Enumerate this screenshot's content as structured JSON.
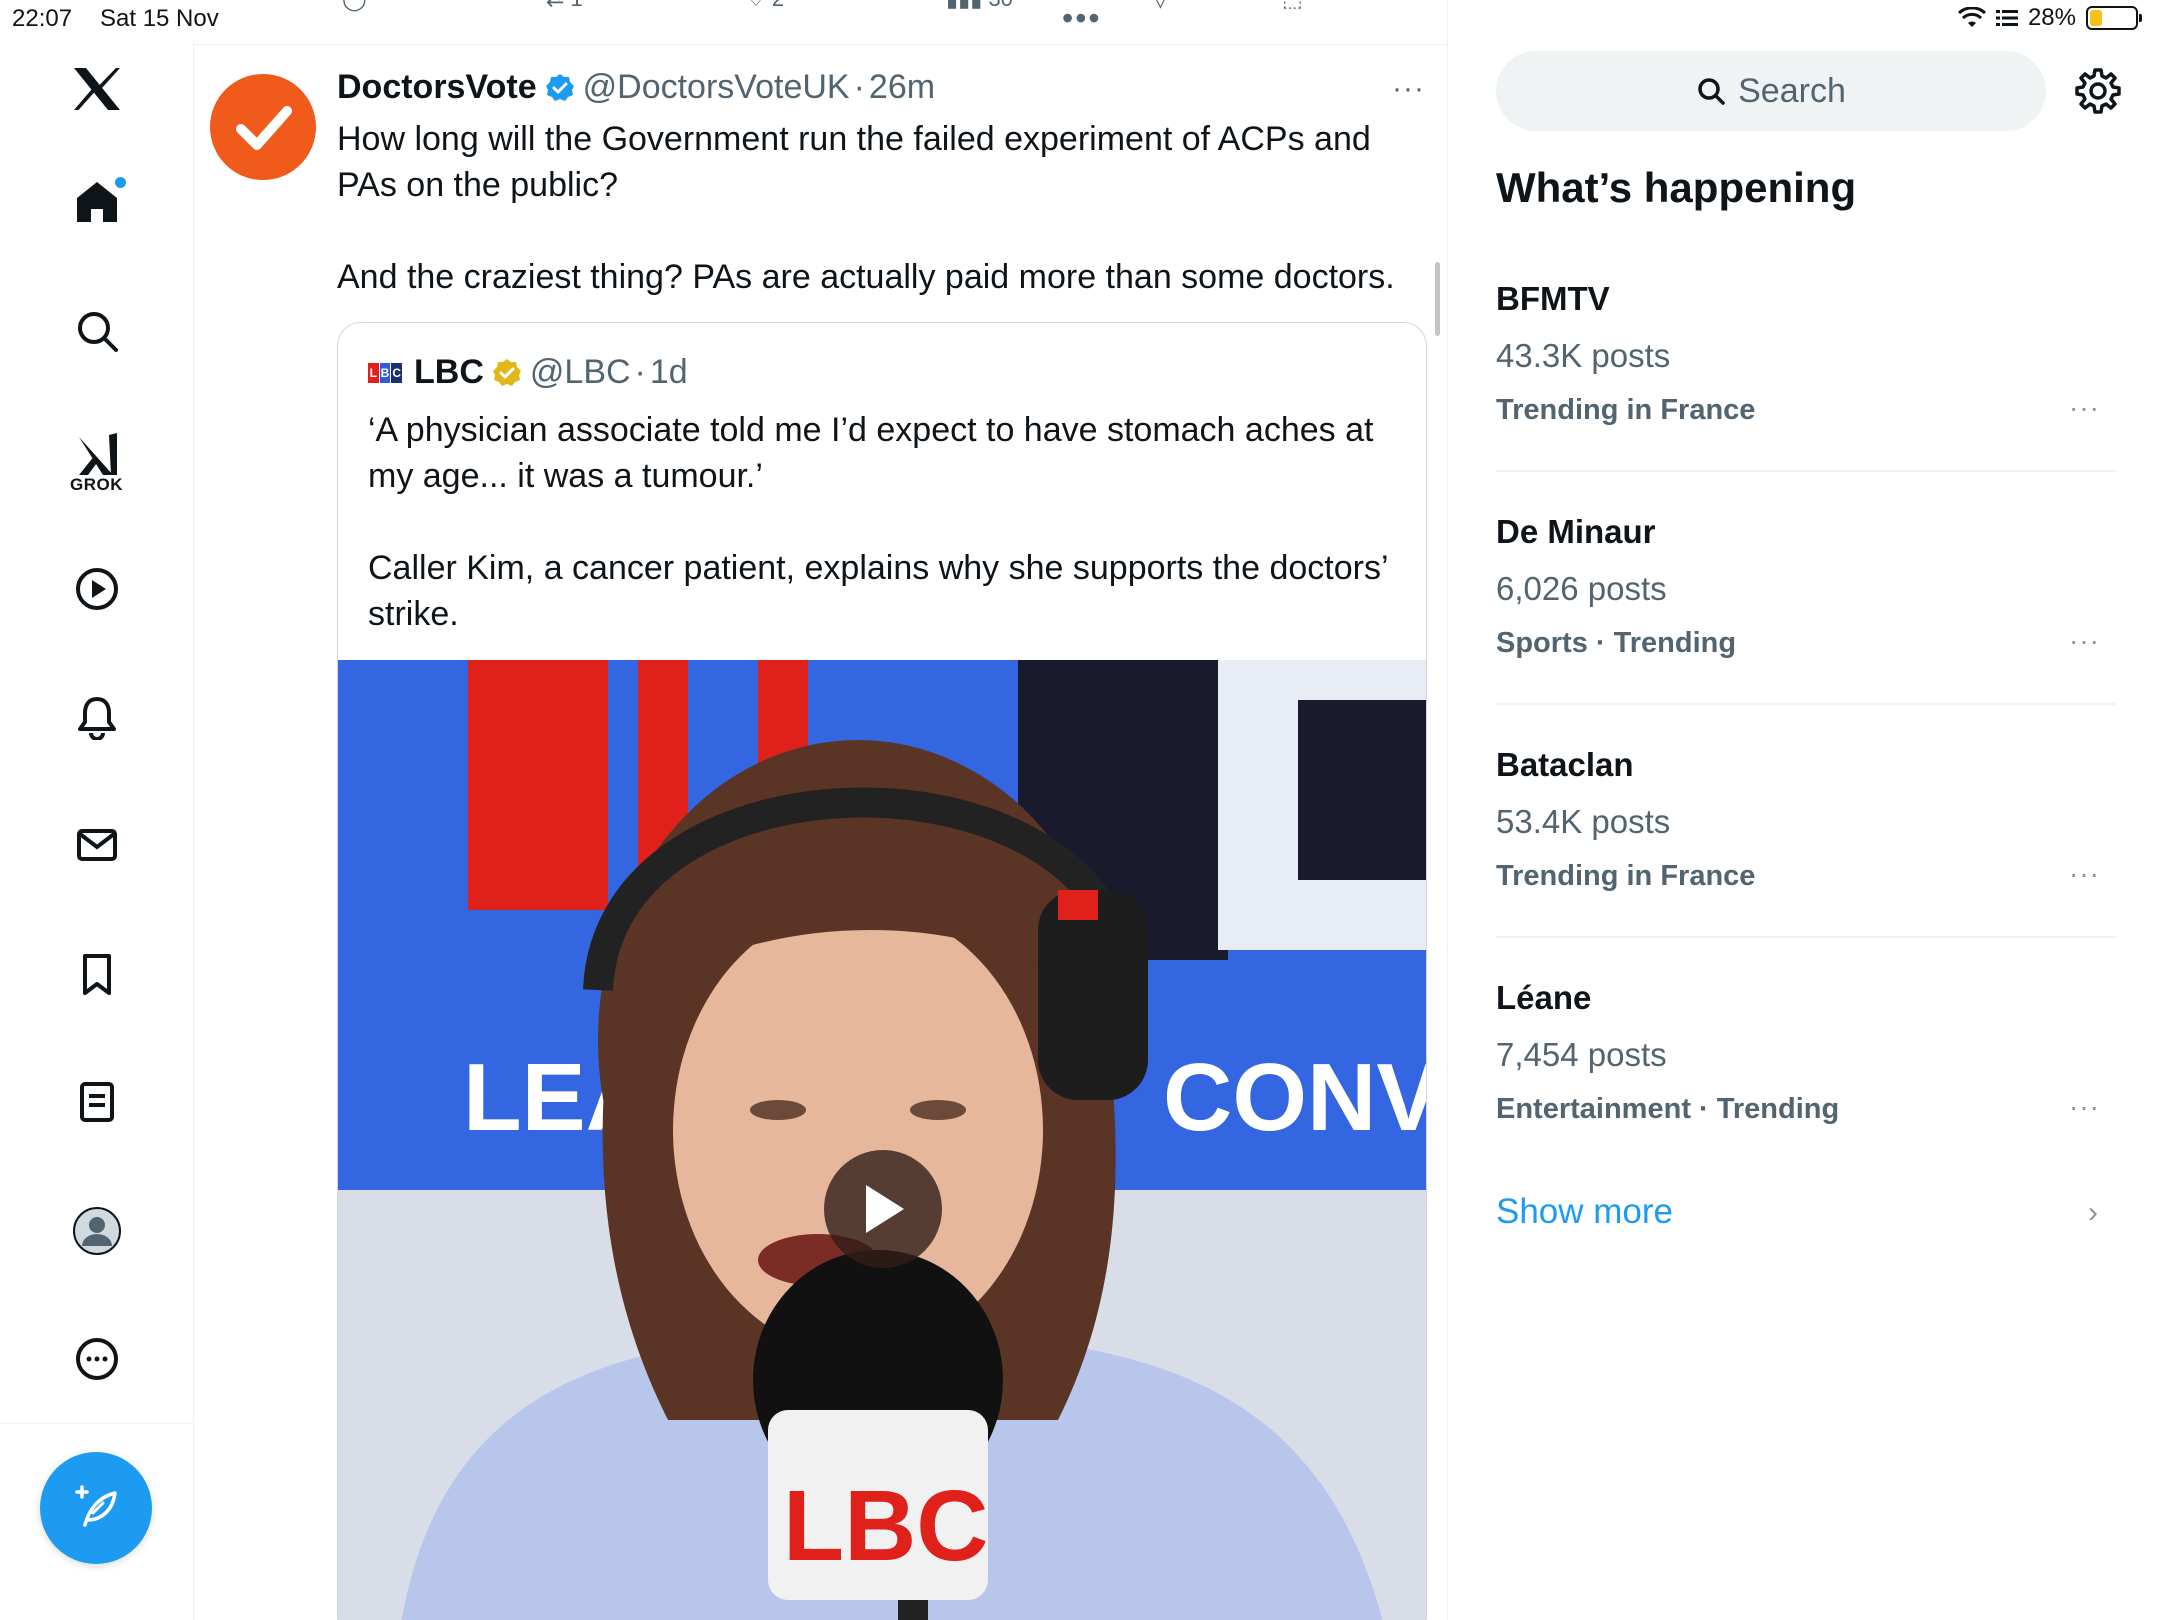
{
  "status_bar": {
    "time": "22:07",
    "date": "Sat 15 Nov",
    "battery": "28%",
    "battery_level": 0.28
  },
  "nav": {
    "grok_label": "GROK",
    "items": [
      "x-logo",
      "home",
      "explore",
      "grok",
      "video",
      "notifications",
      "messages",
      "bookmarks",
      "lists",
      "profile",
      "more"
    ]
  },
  "feed": {
    "prev_action_counts": {
      "retweets": "1",
      "likes": "2",
      "views": "30"
    },
    "tweet": {
      "name": "DoctorsVote",
      "handle": "@DoctorsVoteUK",
      "separator": "·",
      "time": "26m",
      "more": "···",
      "text_1": "How long will the Government run the failed experiment of ACPs and PAs on the public?",
      "text_2": "And the craziest thing? PAs are actually paid more than some doctors."
    },
    "quote": {
      "logo_letters": [
        "L",
        "B",
        "C"
      ],
      "name": "LBC",
      "handle": "@LBC",
      "separator": "·",
      "time": "1d",
      "text_1": "‘A physician associate told me I’d expect to have stomach aches at my age... it was a tumour.’",
      "text_2": "Caller Kim, a cancer patient, explains why she supports the doctors’ strike.",
      "video_bg_text_left": "LEA",
      "video_bg_text_right": "CONVER",
      "mic_label": "LBC"
    }
  },
  "sidebar": {
    "search_placeholder": "Search",
    "section_title": "What’s happening",
    "trends": [
      {
        "name": "BFMTV",
        "posts": "43.3K posts",
        "category": "Trending in France",
        "more": "···"
      },
      {
        "name": "De Minaur",
        "posts": "6,026 posts",
        "category": "Sports · Trending",
        "more": "···"
      },
      {
        "name": "Bataclan",
        "posts": "53.4K posts",
        "category": "Trending in France",
        "more": "···"
      },
      {
        "name": "Léane",
        "posts": "7,454 posts",
        "category": "Entertainment · Trending",
        "more": "···"
      }
    ],
    "show_more": "Show more",
    "show_more_chevron": "›"
  },
  "colors": {
    "accent": "#1d9bf0",
    "text_primary": "#0f1419",
    "text_secondary": "#536471",
    "verified_gold": "#e2b719",
    "doctorsvote_orange": "#f05a1a",
    "lbc_red": "#e0201b",
    "lbc_blue": "#2f5bd8"
  }
}
